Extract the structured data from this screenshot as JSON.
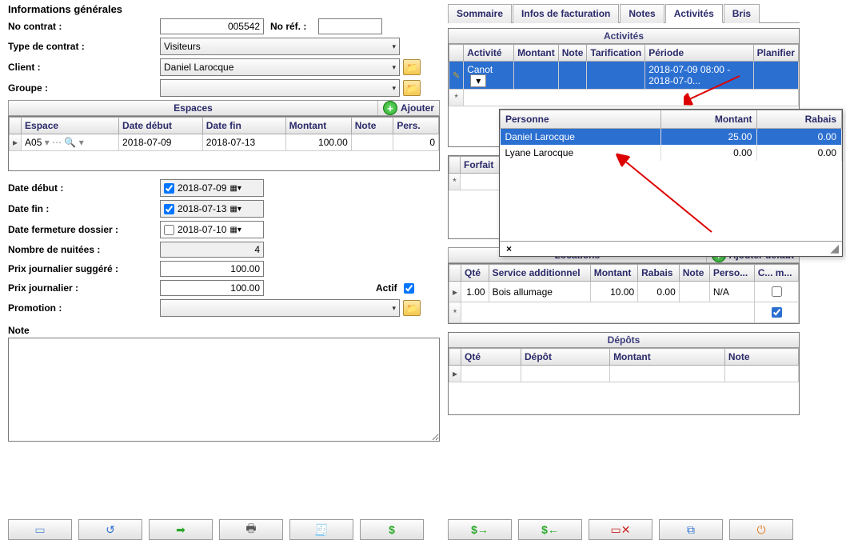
{
  "left": {
    "section_title": "Informations générales",
    "labels": {
      "no_contrat": "No contrat :",
      "no_ref": "No réf. :",
      "type_contrat": "Type de contrat :",
      "client": "Client :",
      "groupe": "Groupe :",
      "date_debut": "Date début :",
      "date_fin": "Date fin :",
      "date_fermeture": "Date fermeture dossier :",
      "nb_nuitees": "Nombre de nuitées :",
      "prix_sugg": "Prix journalier suggéré :",
      "prix": "Prix journalier :",
      "actif": "Actif",
      "promotion": "Promotion :",
      "note": "Note"
    },
    "values": {
      "no_contrat": "005542",
      "no_ref": "",
      "type_contrat": "Visiteurs",
      "client": "Daniel Larocque",
      "groupe": "",
      "date_debut": "2018-07-09",
      "date_fin": "2018-07-13",
      "date_fermeture": "2018-07-10",
      "nb_nuitees": "4",
      "prix_sugg": "100.00",
      "prix": "100.00",
      "promotion": ""
    },
    "espaces": {
      "title": "Espaces",
      "add_label": "Ajouter",
      "columns": [
        "Espace",
        "Date début",
        "Date fin",
        "Montant",
        "Note",
        "Pers."
      ],
      "rows": [
        {
          "espace": "A05",
          "date_debut": "2018-07-09",
          "date_fin": "2018-07-13",
          "montant": "100.00",
          "note": "",
          "pers": "0"
        }
      ]
    }
  },
  "tabs": {
    "items": [
      "Sommaire",
      "Infos de facturation",
      "Notes",
      "Activités",
      "Bris"
    ],
    "active_index": 3
  },
  "activites": {
    "title": "Activités",
    "columns": [
      "Activité",
      "Montant",
      "Note",
      "Tarification",
      "Période",
      "Planifier"
    ],
    "rows": [
      {
        "activite": "Canot",
        "montant": "",
        "note": "",
        "tarification": "",
        "periode": "2018-07-09 08:00 - 2018-07-0...",
        "planifier": ""
      }
    ]
  },
  "popup": {
    "columns": [
      "Personne",
      "Montant",
      "Rabais"
    ],
    "rows": [
      {
        "personne": "Daniel Larocque",
        "montant": "25.00",
        "rabais": "0.00",
        "selected": true
      },
      {
        "personne": "Lyane Larocque",
        "montant": "0.00",
        "rabais": "0.00",
        "selected": false
      }
    ],
    "close": "×"
  },
  "forfait": {
    "header": "Forfait"
  },
  "locations": {
    "title": "Locations",
    "add_label": "Ajouter défaut",
    "columns": [
      "Qté",
      "Service additionnel",
      "Montant",
      "Rabais",
      "Note",
      "Perso...",
      "C... m..."
    ],
    "rows": [
      {
        "qte": "1.00",
        "service": "Bois allumage",
        "montant": "10.00",
        "rabais": "0.00",
        "note": "",
        "perso": "N/A",
        "c": ""
      }
    ]
  },
  "depots": {
    "title": "Dépôts",
    "columns": [
      "Qté",
      "Dépôt",
      "Montant",
      "Note"
    ]
  },
  "toolbar": {
    "icons": [
      "file-icon",
      "undo-icon",
      "export-icon",
      "print-icon",
      "receipt-icon",
      "dollar-icon",
      "dollar-right-icon",
      "dollar-left-icon",
      "cancel-icon",
      "copy-icon",
      "power-icon"
    ]
  }
}
